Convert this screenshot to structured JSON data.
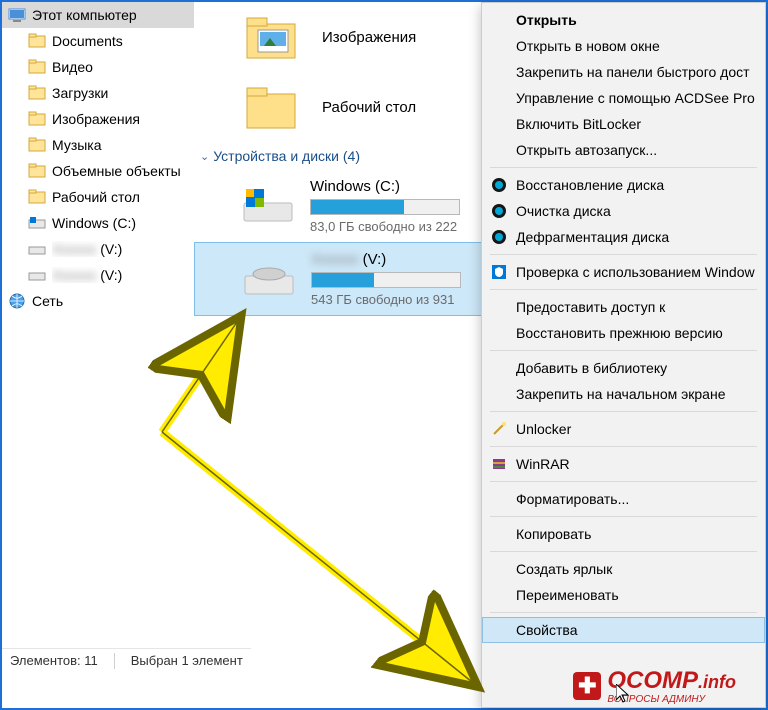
{
  "sidebar": {
    "items": [
      {
        "label": "Этот компьютер",
        "icon": "pc"
      },
      {
        "label": "Documents",
        "icon": "folder"
      },
      {
        "label": "Видео",
        "icon": "folder"
      },
      {
        "label": "Загрузки",
        "icon": "folder"
      },
      {
        "label": "Изображения",
        "icon": "folder"
      },
      {
        "label": "Музыка",
        "icon": "folder"
      },
      {
        "label": "Объемные объекты",
        "icon": "folder"
      },
      {
        "label": "Рабочий стол",
        "icon": "folder"
      },
      {
        "label": "Windows (C:)",
        "icon": "disk-win"
      },
      {
        "label": "Xxxxxx (V:)",
        "icon": "disk",
        "blur": true
      },
      {
        "label": "Xxxxxx (V:)",
        "icon": "disk",
        "blur": true
      },
      {
        "label": "Сеть",
        "icon": "network"
      }
    ]
  },
  "folders": [
    {
      "name": "Изображения"
    },
    {
      "name": "Рабочий стол"
    }
  ],
  "section_header": "Устройства и диски (4)",
  "drives": [
    {
      "name": "Windows (C:)",
      "free": "83,0 ГБ свободно из 222",
      "fill": 63
    },
    {
      "name": "Xxxxxx (V:)",
      "blur": true,
      "free": "543 ГБ свободно из 931",
      "fill": 42
    }
  ],
  "ctx": {
    "items": [
      {
        "t": "Открыть",
        "bold": true
      },
      {
        "t": "Открыть в новом окне"
      },
      {
        "t": "Закрепить на панели быстрого дост"
      },
      {
        "t": "Управление с помощью ACDSee Pro"
      },
      {
        "t": "Включить BitLocker"
      },
      {
        "t": "Открыть автозапуск..."
      },
      {
        "sep": true
      },
      {
        "t": "Восстановление диска",
        "icon": "acronis"
      },
      {
        "t": "Очистка диска",
        "icon": "acronis"
      },
      {
        "t": "Дефрагментация диска",
        "icon": "acronis"
      },
      {
        "sep": true
      },
      {
        "t": "Проверка с использованием Window",
        "icon": "defender"
      },
      {
        "sep": true
      },
      {
        "t": "Предоставить доступ к"
      },
      {
        "t": "Восстановить прежнюю версию"
      },
      {
        "sep": true
      },
      {
        "t": "Добавить в библиотеку"
      },
      {
        "t": "Закрепить на начальном экране"
      },
      {
        "sep": true
      },
      {
        "t": "Unlocker",
        "icon": "unlocker"
      },
      {
        "sep": true
      },
      {
        "t": "WinRAR",
        "icon": "winrar"
      },
      {
        "sep": true
      },
      {
        "t": "Форматировать..."
      },
      {
        "sep": true
      },
      {
        "t": "Копировать"
      },
      {
        "sep": true
      },
      {
        "t": "Создать ярлык"
      },
      {
        "t": "Переименовать"
      },
      {
        "sep": true
      },
      {
        "t": "Свойства",
        "selected": true
      }
    ]
  },
  "status": {
    "count": "Элементов: 11",
    "sel": "Выбран 1 элемент"
  },
  "watermark": {
    "brand": "OCOMP",
    "tld": ".info",
    "sub": "ВОПРОСЫ АДМИНУ"
  }
}
